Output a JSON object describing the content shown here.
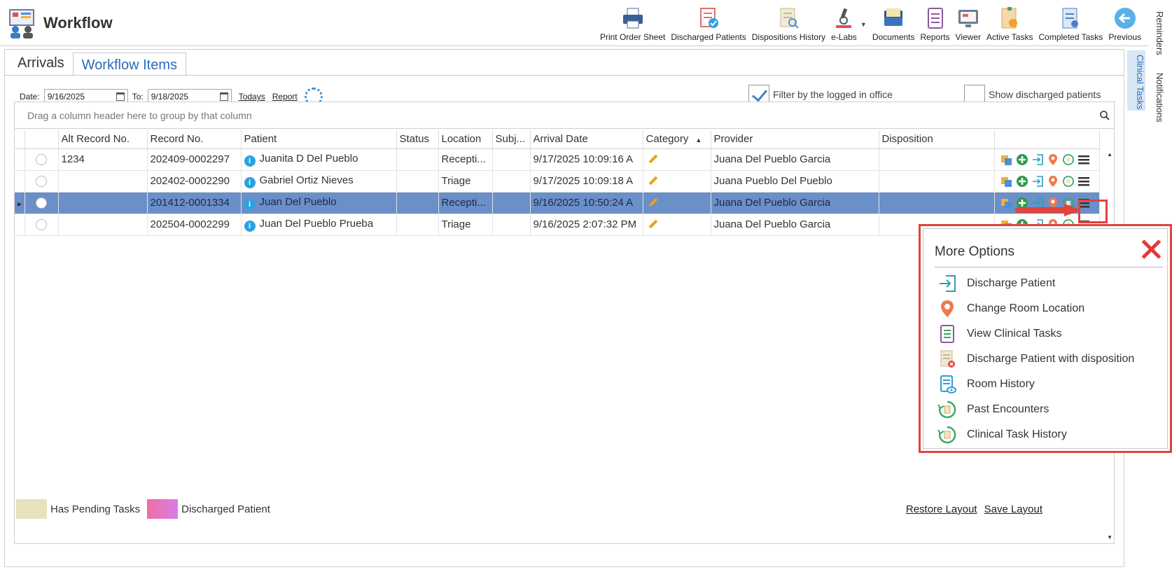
{
  "app": {
    "title": "Workflow"
  },
  "toolbar": [
    {
      "label": "Print Order Sheet",
      "icon": "printer-icon"
    },
    {
      "label": "Discharged Patients",
      "icon": "discharged-patients-icon"
    },
    {
      "label": "Dispositions History",
      "icon": "dispositions-history-icon"
    },
    {
      "label": "e-Labs",
      "icon": "microscope-icon"
    },
    {
      "label": "Documents",
      "icon": "documents-icon"
    },
    {
      "label": "Reports",
      "icon": "reports-icon"
    },
    {
      "label": "Viewer",
      "icon": "viewer-icon"
    },
    {
      "label": "Active Tasks",
      "icon": "active-tasks-icon"
    },
    {
      "label": "Completed Tasks",
      "icon": "completed-tasks-icon"
    },
    {
      "label": "Previous",
      "icon": "back-arrow-icon"
    }
  ],
  "side_tabs": {
    "reminders": "Reminders",
    "notifications": "Notifications",
    "clinical_tasks": "Clinical Tasks"
  },
  "tabs": {
    "arrivals": "Arrivals",
    "workflow_items": "Workflow Items"
  },
  "filters": {
    "date_label": "Date:",
    "date_from": "9/16/2025",
    "to_label": "To:",
    "date_to": "9/18/2025",
    "todays": "Todays",
    "report": "Report",
    "filter_office": "Filter by the logged in office",
    "show_discharged": "Show discharged patients"
  },
  "grid": {
    "group_hint": "Drag a column header here to group by that column",
    "columns": {
      "alt_record": "Alt Record No.",
      "record": "Record No.",
      "patient": "Patient",
      "status": "Status",
      "location": "Location",
      "subject": "Subj...",
      "arrival": "Arrival Date",
      "category": "Category",
      "provider": "Provider",
      "disposition": "Disposition"
    },
    "rows": [
      {
        "alt": "1234",
        "record": "202409-0002297",
        "patient": "Juanita D Del Pueblo",
        "status": "",
        "location": "Recepti...",
        "subject": "",
        "arrival": "9/17/2025 10:09:16 A",
        "provider": "Juana Del Pueblo Garcia",
        "disposition": ""
      },
      {
        "alt": "",
        "record": "202402-0002290",
        "patient": "Gabriel Ortiz Nieves",
        "status": "",
        "location": "Triage",
        "subject": "",
        "arrival": "9/17/2025 10:09:18 A",
        "provider": "Juana Pueblo Del Pueblo",
        "disposition": ""
      },
      {
        "alt": "",
        "record": "201412-0001334",
        "patient": "Juan Del Pueblo",
        "status": "",
        "location": "Recepti...",
        "subject": "",
        "arrival": "9/16/2025 10:50:24 A",
        "provider": "Juana Del Pueblo Garcia",
        "disposition": ""
      },
      {
        "alt": "",
        "record": "202504-0002299",
        "patient": "Juan Del Pueblo Prueba",
        "status": "",
        "location": "Triage",
        "subject": "",
        "arrival": "9/16/2025 2:07:32 PM",
        "provider": "Juana Del Pueblo Garcia",
        "disposition": ""
      }
    ]
  },
  "legend": {
    "pending": "Has Pending Tasks",
    "discharged": "Discharged Patient",
    "pending_color": "#e6e2bd",
    "discharged_color": "#e070c8"
  },
  "footer": {
    "restore": "Restore Layout",
    "save": "Save Layout"
  },
  "popup": {
    "title": "More Options",
    "items": [
      {
        "label": "Discharge Patient",
        "icon": "discharge-icon"
      },
      {
        "label": "Change Room Location",
        "icon": "location-pin-icon"
      },
      {
        "label": "View Clinical Tasks",
        "icon": "clinical-tasks-icon"
      },
      {
        "label": "Discharge Patient with disposition",
        "icon": "discharge-disposition-icon"
      },
      {
        "label": "Room History",
        "icon": "room-history-icon"
      },
      {
        "label": "Past Encounters",
        "icon": "past-encounters-icon"
      },
      {
        "label": "Clinical Task History",
        "icon": "task-history-icon"
      }
    ]
  },
  "colors": {
    "accent": "#2a6db5",
    "selected_row": "#6b8fc8",
    "highlight": "#e0443c"
  }
}
